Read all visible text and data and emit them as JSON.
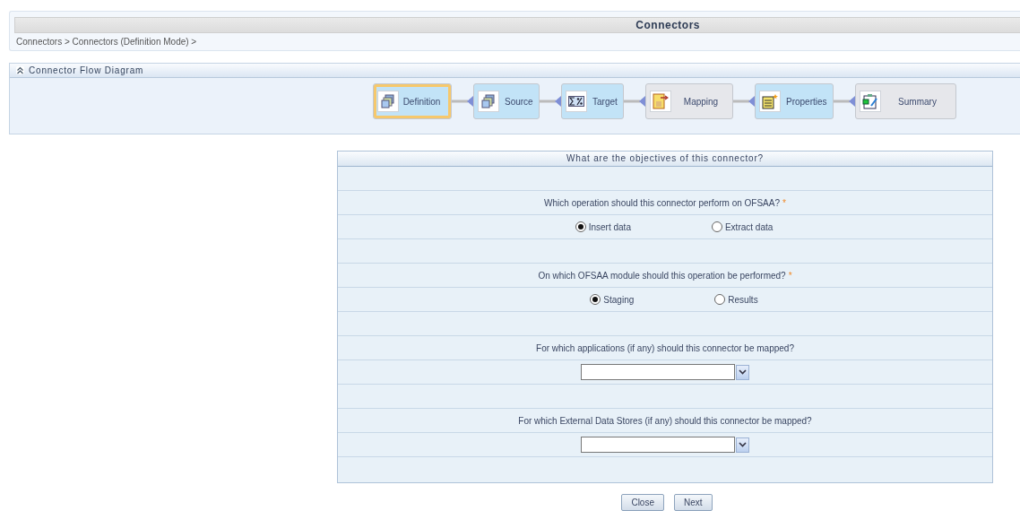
{
  "header": {
    "title": "Connectors",
    "breadcrumb": "Connectors > Connectors (Definition Mode) >"
  },
  "flow": {
    "title": "Connector Flow Diagram",
    "steps": [
      {
        "label": "Definition",
        "selected": true,
        "done": true
      },
      {
        "label": "Source",
        "selected": false,
        "done": true
      },
      {
        "label": "Target",
        "selected": false,
        "done": true
      },
      {
        "label": "Mapping",
        "selected": false,
        "done": false
      },
      {
        "label": "Properties",
        "selected": false,
        "done": true
      },
      {
        "label": "Summary",
        "selected": false,
        "done": false
      }
    ]
  },
  "form": {
    "title": "What are the objectives of this connector?",
    "questions": [
      {
        "kind": "radio",
        "label": "Which operation should this connector perform on OFSAA?",
        "required_mark": "*",
        "options": [
          {
            "label": "Insert data",
            "selected": true
          },
          {
            "label": "Extract data",
            "selected": false
          }
        ]
      },
      {
        "kind": "radio",
        "label": "On which OFSAA module should this operation be performed?",
        "required_mark": "*",
        "options": [
          {
            "label": "Staging",
            "selected": true
          },
          {
            "label": "Results",
            "selected": false
          }
        ]
      },
      {
        "kind": "select",
        "label": "For which applications (if any) should this connector be mapped?"
      },
      {
        "kind": "select",
        "label": "For which External Data Stores (if any) should this connector be mapped?"
      }
    ]
  },
  "buttons": [
    "Close",
    "Next"
  ]
}
